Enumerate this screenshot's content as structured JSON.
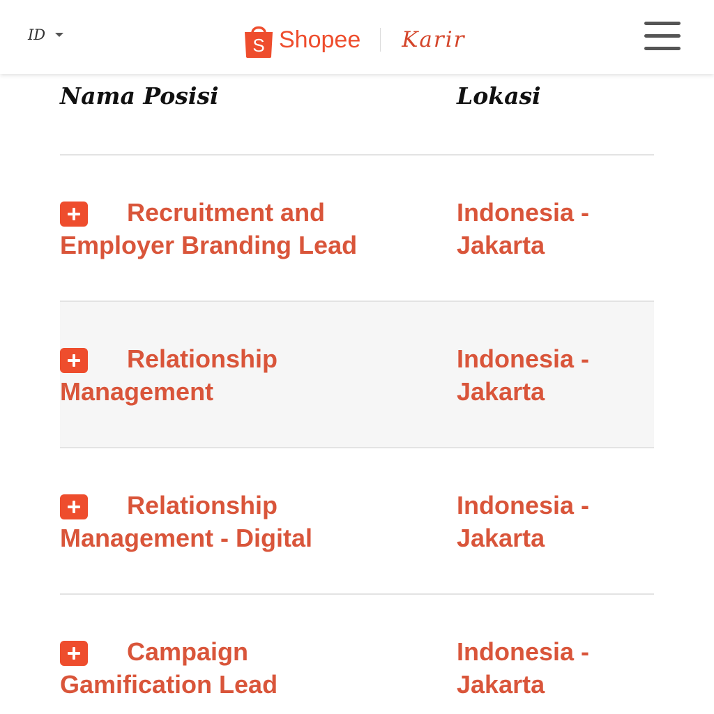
{
  "header": {
    "language": "ID",
    "brand": "Shopee",
    "section": "Karir",
    "accent_color": "#ee4d2d",
    "icons": [
      "language-caret-icon",
      "shopee-bag-icon",
      "hamburger-menu-icon"
    ]
  },
  "table": {
    "columns": {
      "position": "Nama Posisi",
      "location": "Lokasi"
    },
    "rows": [
      {
        "title": "Recruitment and Employer Branding Lead",
        "location": "Indonesia - Jakarta"
      },
      {
        "title": "Relationship Management",
        "location": "Indonesia - Jakarta"
      },
      {
        "title": "Relationship Management - Digital",
        "location": "Indonesia - Jakarta"
      },
      {
        "title": "Campaign Gamification Lead",
        "location": "Indonesia - Jakarta"
      }
    ]
  }
}
